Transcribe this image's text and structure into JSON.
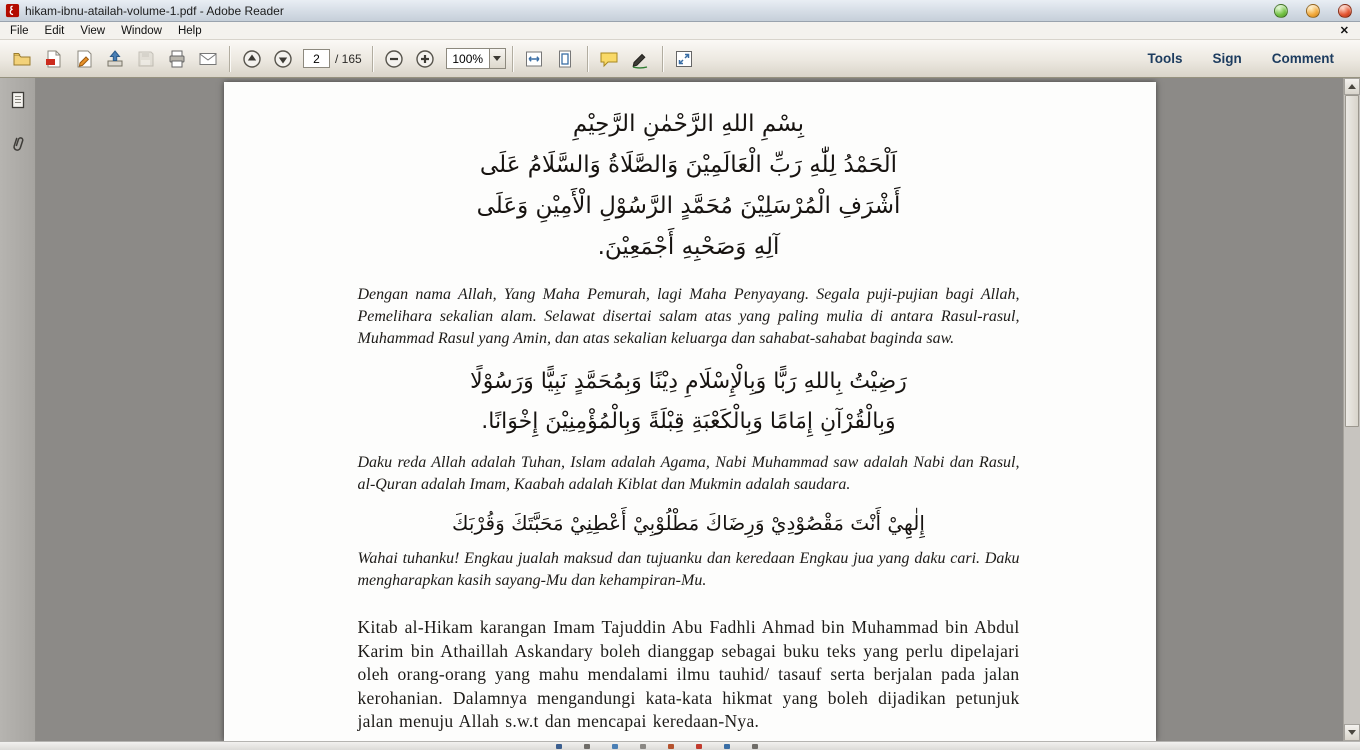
{
  "window": {
    "title": "hikam-ibnu-atailah-volume-1.pdf - Adobe Reader"
  },
  "menubar": {
    "items": [
      "File",
      "Edit",
      "View",
      "Window",
      "Help"
    ],
    "close_glyph": "✕"
  },
  "toolbar": {
    "icons_left": [
      "open-icon",
      "create-pdf-icon",
      "fill-sign-icon",
      "send-file-icon",
      "save-icon",
      "print-icon",
      "email-icon"
    ],
    "nav_icons": [
      "previous-page-icon",
      "next-page-icon"
    ],
    "nav": {
      "page_value": "2",
      "page_total": "/ 165"
    },
    "zoom_icons": [
      "zoom-out-icon",
      "zoom-in-icon"
    ],
    "zoom": {
      "value": "100%"
    },
    "view_icons": [
      "fit-width-icon",
      "fit-page-icon"
    ],
    "annot_icons": [
      "comment-bubble-icon",
      "sign-pen-icon",
      "fullscreen-icon"
    ],
    "panel_buttons": [
      "Tools",
      "Sign",
      "Comment"
    ]
  },
  "sidebar": {
    "icons": [
      "page-thumbnails-icon",
      "attachments-icon"
    ]
  },
  "document": {
    "arabic_1": [
      "بِسْمِ اللهِ الرَّحْمٰنِ الرَّحِيْمِ",
      "اَلْحَمْدُ لِلّٰهِ رَبِّ الْعَالَمِيْنَ وَالصَّلَاةُ وَالسَّلَامُ عَلَى",
      "أَشْرَفِ الْمُرْسَلِيْنَ مُحَمَّدٍ الرَّسُوْلِ الْأَمِيْنِ وَعَلَى",
      "آلِهِ وَصَحْبِهِ أَجْمَعِيْنَ."
    ],
    "trans_1": "Dengan nama Allah, Yang Maha Pemurah, lagi Maha Penyayang. Segala puji-pujian bagi Allah, Pemelihara sekalian alam. Selawat disertai salam atas yang paling mulia di antara Rasul-rasul, Muhammad Rasul yang Amin, dan atas sekalian keluarga dan sahabat-sahabat baginda saw.",
    "arabic_2": [
      "رَضِيْتُ بِاللهِ رَبًّا وَبِالْإِسْلَامِ دِيْنًا وَبِمُحَمَّدٍ نَبِيًّا وَرَسُوْلًا",
      "وَبِالْقُرْآنِ إِمَامًا وَبِالْكَعْبَةِ قِبْلَةً وَبِالْمُؤْمِنِيْنَ إِخْوَانًا."
    ],
    "trans_2": "Daku reda Allah adalah Tuhan, Islam adalah Agama, Nabi Muhammad saw adalah Nabi dan Rasul, al-Quran adalah Imam, Kaabah adalah Kiblat dan Mukmin adalah saudara.",
    "arabic_3": [
      "إِلٰهِيْ أَنْتَ مَقْصُوْدِيْ وَرِضَاكَ مَطْلُوْبِيْ أَعْطِنِيْ مَحَبَّتَكَ وَقُرْبَكَ"
    ],
    "trans_3": "Wahai tuhanku! Engkau jualah maksud dan tujuanku dan keredaan Engkau jua yang daku cari. Daku mengharapkan kasih sayang-Mu dan kehampiran-Mu.",
    "body_1": "Kitab al-Hikam karangan Imam Tajuddin Abu Fadhli Ahmad bin Muhammad bin Abdul Karim bin Athaillah Askandary boleh dianggap sebagai buku teks yang perlu dipelajari oleh orang-orang yang mahu mendalami ilmu tauhid/ tasauf serta berjalan pada jalan kerohanian. Dalamnya mengandungi kata-kata hikmat yang boleh dijadikan petunjuk jalan menuju Allah s.w.t dan mencapai keredaan-Nya."
  },
  "colors": {
    "panel_button_text": "#1d3c5f",
    "comment_bubble": "#f9d967",
    "adobe_red": "#b30b00",
    "doc_background": "#8c8a87"
  }
}
